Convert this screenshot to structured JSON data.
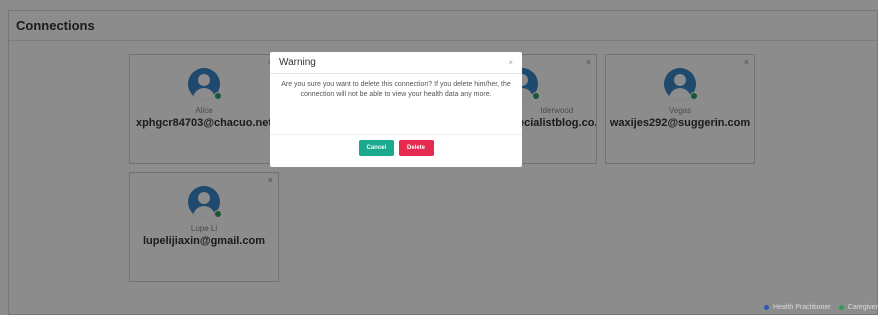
{
  "page": {
    "title": "Connections"
  },
  "cards": [
    {
      "name": "Alice",
      "email": "xphgcr84703@chacuo.net"
    },
    {
      "name": "",
      "email": ""
    },
    {
      "name": "lderwood",
      "email": "ecialistblog.co..."
    },
    {
      "name": "Vegas",
      "email": "waxijes292@suggerin.com"
    },
    {
      "name": "Lupe Li",
      "email": "lupelijiaxin@gmail.com"
    }
  ],
  "card_close_glyph": "×",
  "modal": {
    "title": "Warning",
    "close_glyph": "×",
    "message": "Are you sure you want to delete this connection? If you delete him/her, the connection will not be able to view your health data any more.",
    "cancel_label": "Cancel",
    "delete_label": "Delete"
  },
  "legend": {
    "items": [
      {
        "label": "Health Practitioner",
        "color": "#2b58b5"
      },
      {
        "label": "Caregiver",
        "color": "#2e9e5b"
      }
    ]
  },
  "colors": {
    "avatar": "#3a88c9",
    "status_online": "#2e9e5b",
    "cancel_button": "#1aa88f",
    "delete_button": "#e6294e"
  },
  "icons": {
    "avatar": "user-avatar-icon",
    "close": "close-icon"
  }
}
